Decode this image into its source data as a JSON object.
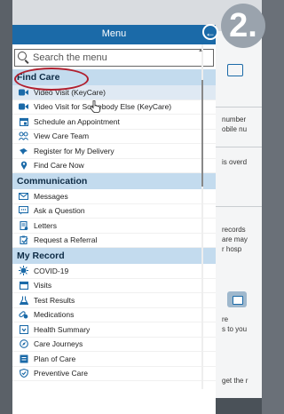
{
  "badge": {
    "number": "2."
  },
  "menu": {
    "title": "Menu",
    "search_placeholder": "Search the menu",
    "sections": [
      {
        "title": "Find Care",
        "items": [
          {
            "label": "Video Visit (KeyCare)",
            "icon": "video-camera-icon"
          },
          {
            "label": "Video Visit for Somebody Else (KeyCare)",
            "icon": "video-camera-icon"
          },
          {
            "label": "Schedule an Appointment",
            "icon": "calendar-plus-icon"
          },
          {
            "label": "View Care Team",
            "icon": "care-team-icon"
          },
          {
            "label": "Register for My Delivery",
            "icon": "stork-icon"
          },
          {
            "label": "Find Care Now",
            "icon": "map-pin-icon"
          }
        ]
      },
      {
        "title": "Communication",
        "items": [
          {
            "label": "Messages",
            "icon": "envelope-icon"
          },
          {
            "label": "Ask a Question",
            "icon": "chat-bubble-icon"
          },
          {
            "label": "Letters",
            "icon": "letter-icon"
          },
          {
            "label": "Request a Referral",
            "icon": "referral-icon"
          }
        ]
      },
      {
        "title": "My Record",
        "items": [
          {
            "label": "COVID-19",
            "icon": "virus-icon"
          },
          {
            "label": "Visits",
            "icon": "calendar-icon"
          },
          {
            "label": "Test Results",
            "icon": "flask-icon"
          },
          {
            "label": "Medications",
            "icon": "pills-icon"
          },
          {
            "label": "Health Summary",
            "icon": "summary-icon"
          },
          {
            "label": "Care Journeys",
            "icon": "compass-icon"
          },
          {
            "label": "Plan of Care",
            "icon": "plan-icon"
          },
          {
            "label": "Preventive Care",
            "icon": "shield-icon"
          }
        ]
      }
    ]
  },
  "background": {
    "fragments": [
      "number",
      "obile nu",
      "is overd",
      "records",
      "are may",
      "r hosp",
      "re",
      "s to you",
      "get the r"
    ]
  }
}
